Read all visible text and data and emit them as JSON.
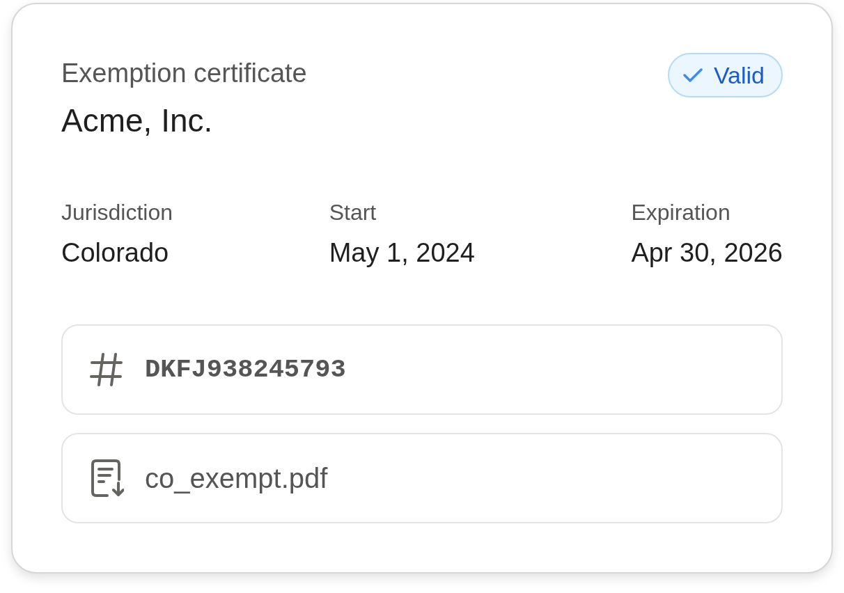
{
  "card": {
    "title": "Exemption certificate",
    "name": "Acme, Inc.",
    "status": {
      "kind": "valid",
      "label": "Valid"
    }
  },
  "details": [
    {
      "label": "Jurisdiction",
      "value": "Colorado"
    },
    {
      "label": "Start",
      "value": "May 1, 2024"
    },
    {
      "label": "Expiration",
      "value": "Apr 30, 2026"
    }
  ],
  "fields": [
    {
      "kind": "number",
      "text": "DKFJ938245793"
    },
    {
      "kind": "file",
      "text": "co_exempt.pdf"
    }
  ]
}
